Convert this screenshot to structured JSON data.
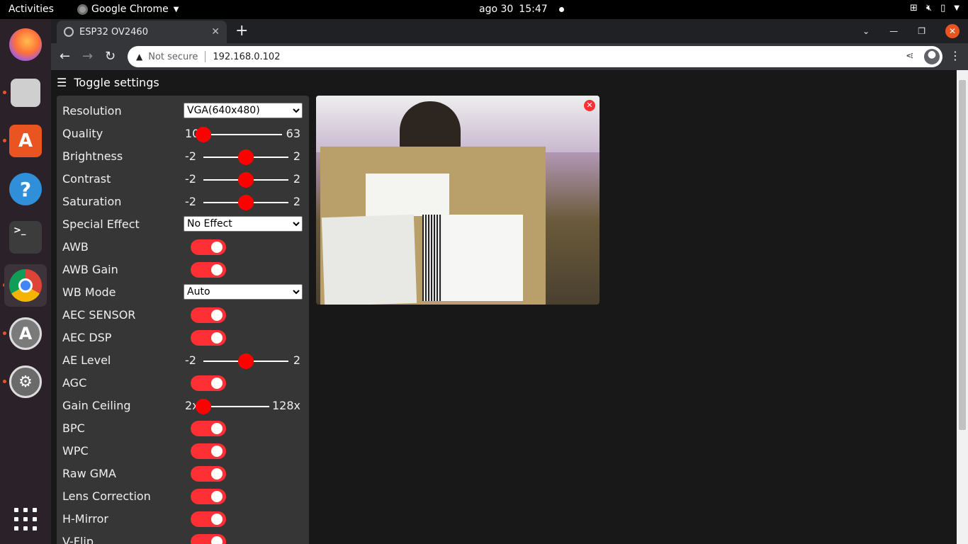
{
  "topbar": {
    "activities": "Activities",
    "app_name": "Google Chrome",
    "date": "ago 30",
    "time": "15:47"
  },
  "dock": {
    "items": [
      "firefox",
      "files",
      "app-center",
      "help",
      "terminal",
      "chrome",
      "software-updater",
      "settings"
    ]
  },
  "browser": {
    "tab_title": "ESP32 OV2460",
    "security_text": "Not secure",
    "url": "192.168.0.102"
  },
  "page": {
    "toggle_label": "Toggle settings",
    "settings": [
      {
        "label": "Resolution",
        "type": "select",
        "value": "VGA(640x480)"
      },
      {
        "label": "Quality",
        "type": "range",
        "min": "10",
        "max": "63",
        "value": 10
      },
      {
        "label": "Brightness",
        "type": "range",
        "min": "-2",
        "max": "2",
        "value": 0
      },
      {
        "label": "Contrast",
        "type": "range",
        "min": "-2",
        "max": "2",
        "value": 0
      },
      {
        "label": "Saturation",
        "type": "range",
        "min": "-2",
        "max": "2",
        "value": 0
      },
      {
        "label": "Special Effect",
        "type": "select",
        "value": "No Effect"
      },
      {
        "label": "AWB",
        "type": "switch",
        "on": true
      },
      {
        "label": "AWB Gain",
        "type": "switch",
        "on": true
      },
      {
        "label": "WB Mode",
        "type": "select",
        "value": "Auto"
      },
      {
        "label": "AEC SENSOR",
        "type": "switch",
        "on": true
      },
      {
        "label": "AEC DSP",
        "type": "switch",
        "on": true
      },
      {
        "label": "AE Level",
        "type": "range",
        "min": "-2",
        "max": "2",
        "value": 0
      },
      {
        "label": "AGC",
        "type": "switch",
        "on": true
      },
      {
        "label": "Gain Ceiling",
        "type": "range",
        "min": "2x",
        "max": "128x",
        "value": 0
      },
      {
        "label": "BPC",
        "type": "switch",
        "on": true
      },
      {
        "label": "WPC",
        "type": "switch",
        "on": true
      },
      {
        "label": "Raw GMA",
        "type": "switch",
        "on": true
      },
      {
        "label": "Lens Correction",
        "type": "switch",
        "on": true
      },
      {
        "label": "H-Mirror",
        "type": "switch",
        "on": true
      },
      {
        "label": "V-Flip",
        "type": "switch",
        "on": true
      }
    ]
  },
  "colors": {
    "accent": "#ff3034",
    "panel": "#363636",
    "page_bg": "#181818"
  }
}
